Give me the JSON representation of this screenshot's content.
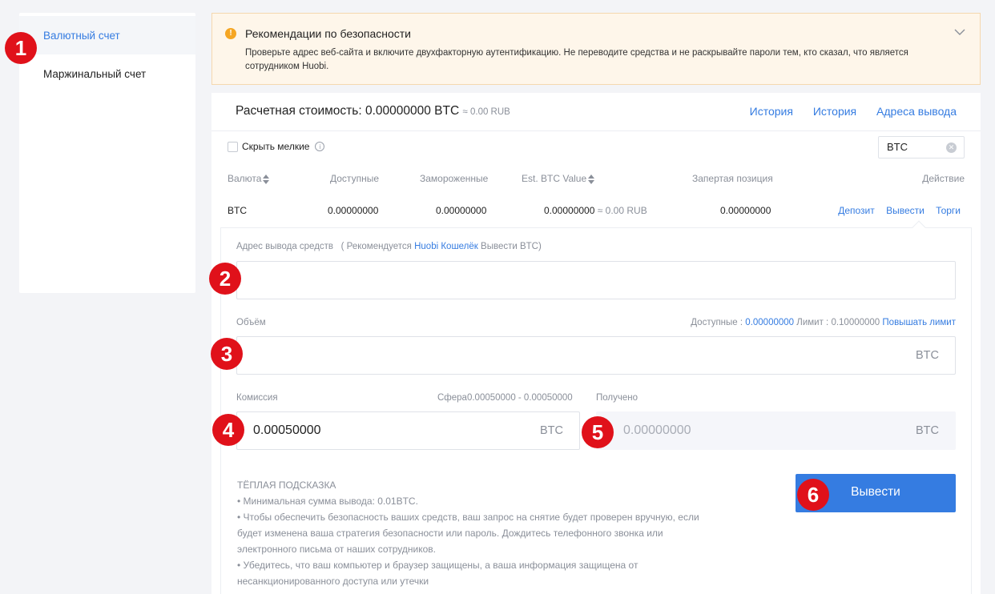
{
  "sidebar": {
    "items": [
      {
        "label": "Валютный счет"
      },
      {
        "label": "Маржинальный счет"
      }
    ]
  },
  "alert": {
    "icon": "exclamation-icon",
    "title": "Рекомендации по безопасности",
    "text": "Проверьте адрес веб-сайта и включите двухфакторную аутентификацию. Не переводите средства и не раскрывайте пароли тем, кто сказал, что является сотрудником Huobi."
  },
  "topbar": {
    "est_label": "Расчетная стоимость: 0.00000000 BTC",
    "est_sub": "≈ 0.00 RUB",
    "links": [
      "История",
      "История",
      "Адреса вывода"
    ]
  },
  "filter": {
    "hide_small_label": "Скрыть мелкие",
    "search_value": "BTC"
  },
  "table": {
    "headers": [
      "Валюта",
      "Доступные",
      "Замороженные",
      "Est. BTC Value",
      "Запертая позиция",
      "Действие"
    ],
    "row": {
      "currency": "BTC",
      "available": "0.00000000",
      "frozen": "0.00000000",
      "est_value": "0.00000000",
      "est_value_sub": "≈ 0.00 RUB",
      "locked": "0.00000000",
      "actions": [
        "Депозит",
        "Вывести",
        "Торги"
      ]
    }
  },
  "form": {
    "address_label": "Адрес вывода средств",
    "address_hint_pre": "( Рекомендуется",
    "address_hint_link": "Huobi Кошелёк",
    "address_hint_post": "Вывести BTC)",
    "address_value": "",
    "amount_label": "Объём",
    "available_label": "Доступные :",
    "available_value": "0.00000000",
    "limit_label": "Лимит :",
    "limit_value": "0.10000000",
    "raise_limit": "Повышать лимит",
    "amount_unit": "BTC",
    "fee_label": "Комиссия",
    "fee_range": "Сфера0.00050000 - 0.00050000",
    "fee_value": "0.00050000",
    "fee_unit": "BTC",
    "received_label": "Получено",
    "received_value": "0.00000000",
    "received_unit": "BTC"
  },
  "tips": {
    "title": "ТЁПЛАЯ ПОДСКАЗКА",
    "lines": [
      "• Минимальная сумма вывода: 0.01BTC.",
      "• Чтобы обеспечить безопасность ваших средств, ваш запрос на снятие будет проверен вручную, если будет изменена ваша стратегия безопасности или пароль. Дождитесь телефонного звонка или электронного письма от наших сотрудников.",
      "• Убедитесь, что ваш компьютер и браузер защищены, а ваша информация защищена от несанкционированного доступа или утечки"
    ]
  },
  "submit_label": "Вывести",
  "badges": [
    "1",
    "2",
    "3",
    "4",
    "5",
    "6"
  ],
  "colors": {
    "accent": "#357ce1",
    "badge": "#e0111a",
    "warning": "#f5a623"
  }
}
